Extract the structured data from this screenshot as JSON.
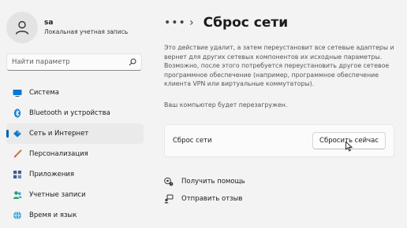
{
  "profile": {
    "name": "sa",
    "account_type": "Локальная учетная запись"
  },
  "search": {
    "placeholder": "Найти параметр"
  },
  "sidebar": {
    "items": [
      {
        "label": "Система",
        "icon": "monitor-icon",
        "active": false
      },
      {
        "label": "Bluetooth и устройства",
        "icon": "bluetooth-icon",
        "active": false
      },
      {
        "label": "Сеть и Интернет",
        "icon": "wifi-diamond-icon",
        "active": true
      },
      {
        "label": "Персонализация",
        "icon": "brush-icon",
        "active": false
      },
      {
        "label": "Приложения",
        "icon": "apps-icon",
        "active": false
      },
      {
        "label": "Учетные записи",
        "icon": "accounts-icon",
        "active": false
      },
      {
        "label": "Время и язык",
        "icon": "globe-clock-icon",
        "active": false
      }
    ]
  },
  "header": {
    "overflow": "•••",
    "separator": "›",
    "title": "Сброс сети"
  },
  "main": {
    "description": "Это действие удалит, а затем переустановит все сетевые адаптеры и вернет для других сетевых компонентов их исходные параметры. Возможно, после этого потребуется переустановить другое сетевое программное обеспечение (например, программное обеспечение клиента VPN или виртуальные коммутаторы).",
    "restart_note": "Ваш компьютер будет перезагружен.",
    "reset_card": {
      "label": "Сброс сети",
      "button_label": "Сбросить сейчас"
    },
    "links": [
      {
        "label": "Получить помощь",
        "icon": "help-icon"
      },
      {
        "label": "Отправить отзыв",
        "icon": "feedback-icon"
      }
    ]
  },
  "colors": {
    "accent": "#005fb8",
    "background": "#f3f3f3",
    "card": "#fbfbfb"
  }
}
